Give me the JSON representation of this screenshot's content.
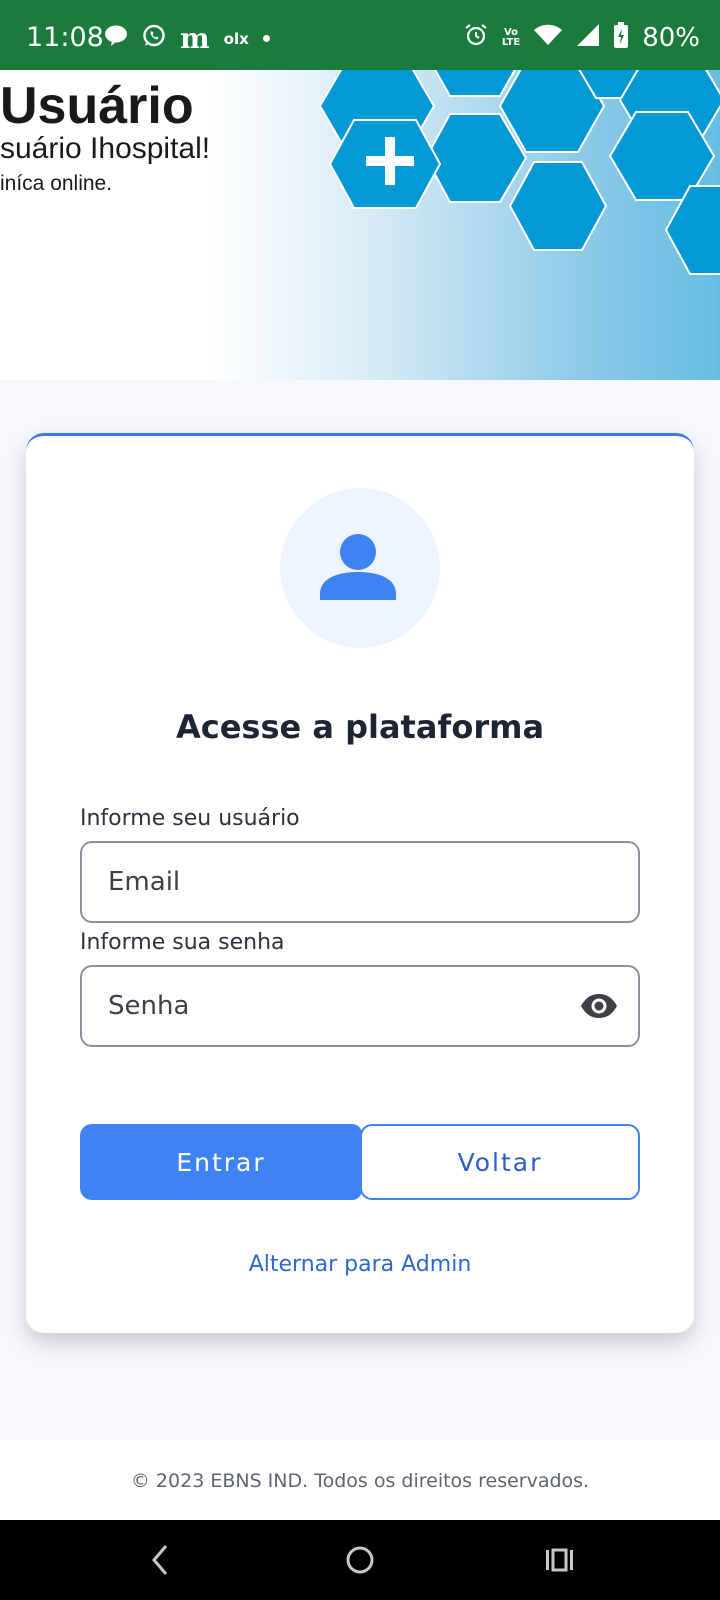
{
  "status_bar": {
    "time": "11:08",
    "notification_m": "m",
    "notification_olx": "olx",
    "volte_top": "Vo",
    "volte_bottom": "LTE",
    "battery": "80%",
    "background_color": "#1b7b3c"
  },
  "banner": {
    "title": "Usuário",
    "subtitle": "suário Ihospital!",
    "subtitle2": "iníca online.",
    "hex_color": "#0399d4"
  },
  "login_card": {
    "title": "Acesse a plataforma",
    "user_label": "Informe seu usuário",
    "email_placeholder": "Email",
    "password_label": "Informe sua senha",
    "password_placeholder": "Senha",
    "submit_label": "Entrar",
    "back_label": "Voltar",
    "switch_label": "Alternar para Admin",
    "accent_color": "#3f82f2"
  },
  "footer": {
    "copyright": "© 2023 EBNS IND. Todos os direitos reservados."
  }
}
